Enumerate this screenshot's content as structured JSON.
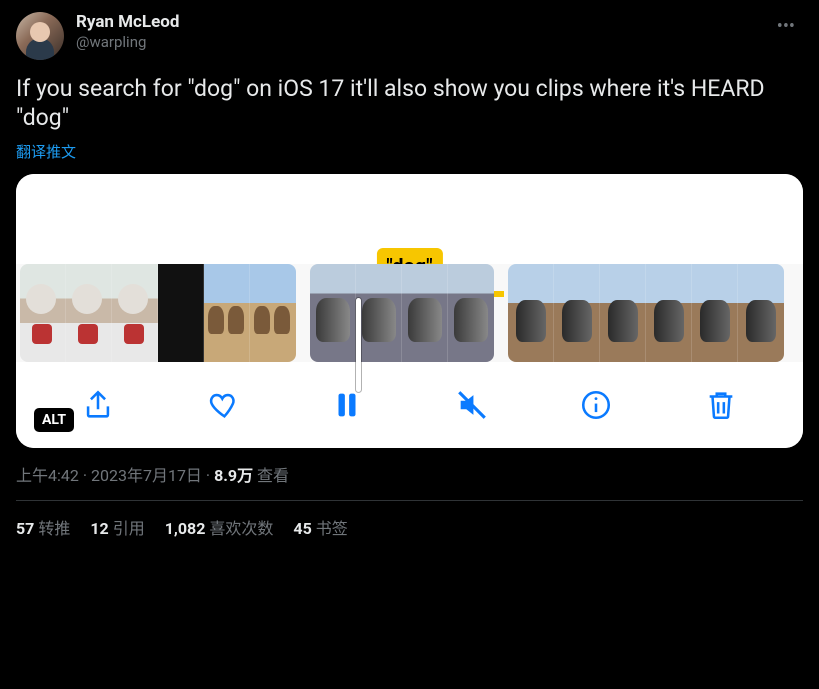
{
  "author": {
    "name": "Ryan McLeod",
    "handle": "@warpling"
  },
  "tweet_text": "If you search for \"dog\" on iOS 17 it'll also show you clips where it's HEARD \"dog\"",
  "translate_label": "翻译推文",
  "media": {
    "search_tag": "\"dog\"",
    "alt_badge": "ALT",
    "toolbar_icons": {
      "share": "share-icon",
      "like": "heart-icon",
      "pause": "pause-icon",
      "mute": "speaker-muted-icon",
      "info": "info-icon",
      "delete": "trash-icon"
    }
  },
  "meta": {
    "time": "上午4:42",
    "date": "2023年7月17日",
    "views_count": "8.9万",
    "views_label": "查看",
    "sep": " · "
  },
  "stats": {
    "retweets": {
      "count": "57",
      "label": "转推"
    },
    "quotes": {
      "count": "12",
      "label": "引用"
    },
    "likes": {
      "count": "1,082",
      "label": "喜欢次数"
    },
    "bookmarks": {
      "count": "45",
      "label": "书签"
    }
  }
}
